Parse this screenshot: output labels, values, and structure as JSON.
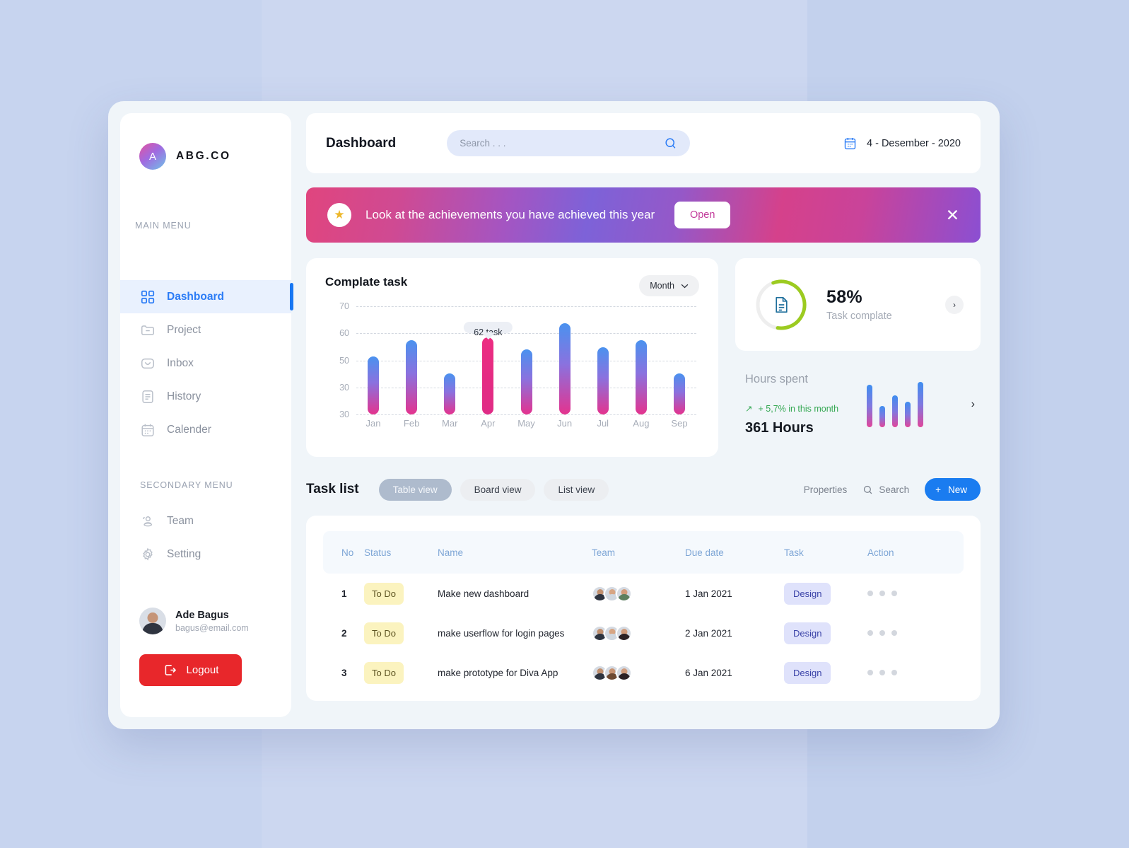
{
  "brand": {
    "initial": "A",
    "name": "ABG.CO"
  },
  "sidebar": {
    "main_menu_label": "MAIN MENU",
    "secondary_menu_label": "SECONDARY MENU",
    "main_items": [
      {
        "label": "Dashboard",
        "icon": "grid-icon",
        "active": true
      },
      {
        "label": "Project",
        "icon": "folder-icon",
        "active": false
      },
      {
        "label": "Inbox",
        "icon": "envelope-icon",
        "active": false
      },
      {
        "label": "History",
        "icon": "document-lines-icon",
        "active": false
      },
      {
        "label": "Calender",
        "icon": "calendar-icon",
        "active": false
      }
    ],
    "secondary_items": [
      {
        "label": "Team",
        "icon": "users-icon"
      },
      {
        "label": "Setting",
        "icon": "gear-icon"
      }
    ],
    "user": {
      "name": "Ade Bagus",
      "email": "bagus@email.com"
    },
    "logout_label": "Logout"
  },
  "topbar": {
    "title": "Dashboard",
    "search_placeholder": "Search . . .",
    "search_value": "",
    "date": "4 - Desember - 2020"
  },
  "banner": {
    "text": "Look at the achievements you have achieved this year",
    "open_label": "Open",
    "close_label": "✕",
    "star_glyph": "★"
  },
  "chart_card": {
    "title": "Complate task",
    "period_label": "Month",
    "tooltip": "62 task"
  },
  "chart_data": {
    "type": "bar",
    "title": "Complate task",
    "categories": [
      "Jan",
      "Feb",
      "Mar",
      "Apr",
      "May",
      "Jun",
      "Jul",
      "Aug",
      "Sep"
    ],
    "values": [
      54,
      61,
      47,
      62,
      57,
      68,
      58,
      61,
      47
    ],
    "highlight_index": 3,
    "annotation": "62 task",
    "ytick_labels": [
      "70",
      "60",
      "50",
      "30",
      "30"
    ],
    "ylim": [
      30,
      75
    ],
    "xlabel": "",
    "ylabel": "",
    "grid": true,
    "legend": "none"
  },
  "donut_card": {
    "percent_label": "58%",
    "caption": "Task complate",
    "value": 58,
    "track_color": "#eeeeee",
    "progress_color": "#9ccb20",
    "icon": "document-icon",
    "chevron": "›"
  },
  "hours_card": {
    "title": "Hours spent",
    "trend": "+ 5,7% in this month",
    "trend_arrow": "↗",
    "value": "361 Hours",
    "chevron": "›",
    "mini_bars": [
      60,
      30,
      45,
      36,
      64
    ]
  },
  "task_section": {
    "title": "Task list",
    "views": [
      {
        "label": "Table view",
        "active": true
      },
      {
        "label": "Board view",
        "active": false
      },
      {
        "label": "List view",
        "active": false
      }
    ],
    "properties_label": "Properties",
    "search_label": "Search",
    "new_label": "New",
    "new_plus": "+"
  },
  "table": {
    "columns": [
      "No",
      "Status",
      "Name",
      "Team",
      "Due date",
      "Task",
      "Action"
    ],
    "rows": [
      {
        "no": "1",
        "status": "To Do",
        "name": "Make new dashboard",
        "team": [
          "a",
          "b",
          "c"
        ],
        "due_date": "1 Jan 2021",
        "task": "Design"
      },
      {
        "no": "2",
        "status": "To Do",
        "name": "make userflow for login pages",
        "team": [
          "a",
          "b",
          "d"
        ],
        "due_date": "2 Jan 2021",
        "task": "Design"
      },
      {
        "no": "3",
        "status": "To Do",
        "name": "make prototype for Diva App",
        "team": [
          "a",
          "e",
          "d"
        ],
        "due_date": "6 Jan 2021",
        "task": "Design"
      }
    ]
  },
  "colors": {
    "accent_blue": "#1a7cf0",
    "logout_red": "#e8272b",
    "status_badge_bg": "#fbf3bf",
    "task_badge_bg": "#dfe2fb",
    "donut_green": "#9ccb20",
    "trend_green": "#34a853"
  }
}
